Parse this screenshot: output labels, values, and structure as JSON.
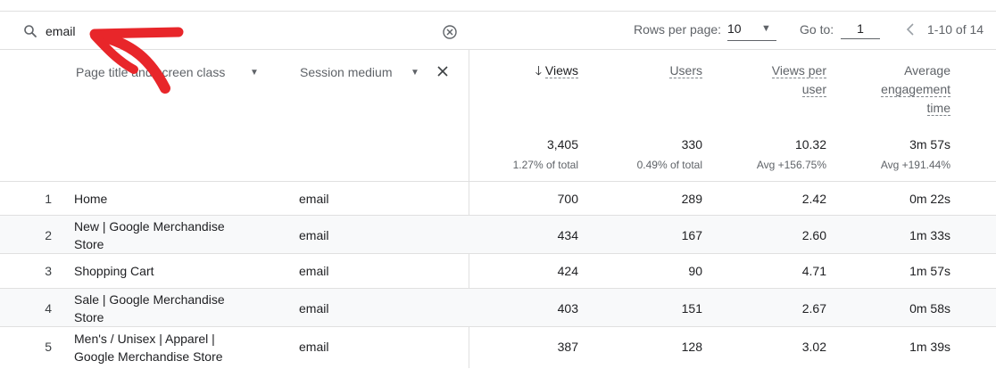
{
  "toolbar": {
    "search_value": "email",
    "rows_per_page_label": "Rows per page:",
    "rows_per_page_value": "10",
    "goto_label": "Go to:",
    "goto_value": "1",
    "page_range": "1-10 of 14"
  },
  "header": {
    "dimension1": "Page title and screen class",
    "dimension2": "Session medium",
    "views": "Views",
    "users": "Users",
    "views_per_user_l1": "Views per",
    "views_per_user_l2": "user",
    "avg_eng_l1": "Average",
    "avg_eng_l2": "engagement",
    "avg_eng_l3": "time"
  },
  "totals": {
    "views": "3,405",
    "views_sub": "1.27% of total",
    "users": "330",
    "users_sub": "0.49% of total",
    "vpu": "10.32",
    "vpu_sub": "Avg +156.75%",
    "aet": "3m 57s",
    "aet_sub": "Avg +191.44%"
  },
  "rows": [
    {
      "idx": "1",
      "title_l1": "Home",
      "title_l2": "",
      "medium": "email",
      "views": "700",
      "users": "289",
      "vpu": "2.42",
      "aet": "0m 22s"
    },
    {
      "idx": "2",
      "title_l1": "New | Google Merchandise",
      "title_l2": "Store",
      "medium": "email",
      "views": "434",
      "users": "167",
      "vpu": "2.60",
      "aet": "1m 33s"
    },
    {
      "idx": "3",
      "title_l1": "Shopping Cart",
      "title_l2": "",
      "medium": "email",
      "views": "424",
      "users": "90",
      "vpu": "4.71",
      "aet": "1m 57s"
    },
    {
      "idx": "4",
      "title_l1": "Sale | Google Merchandise",
      "title_l2": "Store",
      "medium": "email",
      "views": "403",
      "users": "151",
      "vpu": "2.67",
      "aet": "0m 58s"
    },
    {
      "idx": "5",
      "title_l1": "Men's / Unisex | Apparel |",
      "title_l2": "Google Merchandise Store",
      "medium": "email",
      "views": "387",
      "users": "128",
      "vpu": "3.02",
      "aet": "1m 39s"
    }
  ],
  "colors": {
    "annotation_arrow": "#e8262a",
    "sorted_header": "#202124",
    "muted": "#5f6368"
  },
  "icons": {
    "search": "search-icon",
    "clear": "clear-circle-icon",
    "prev": "chevron-left-icon",
    "sort": "arrow-down-icon",
    "remove": "close-icon"
  }
}
